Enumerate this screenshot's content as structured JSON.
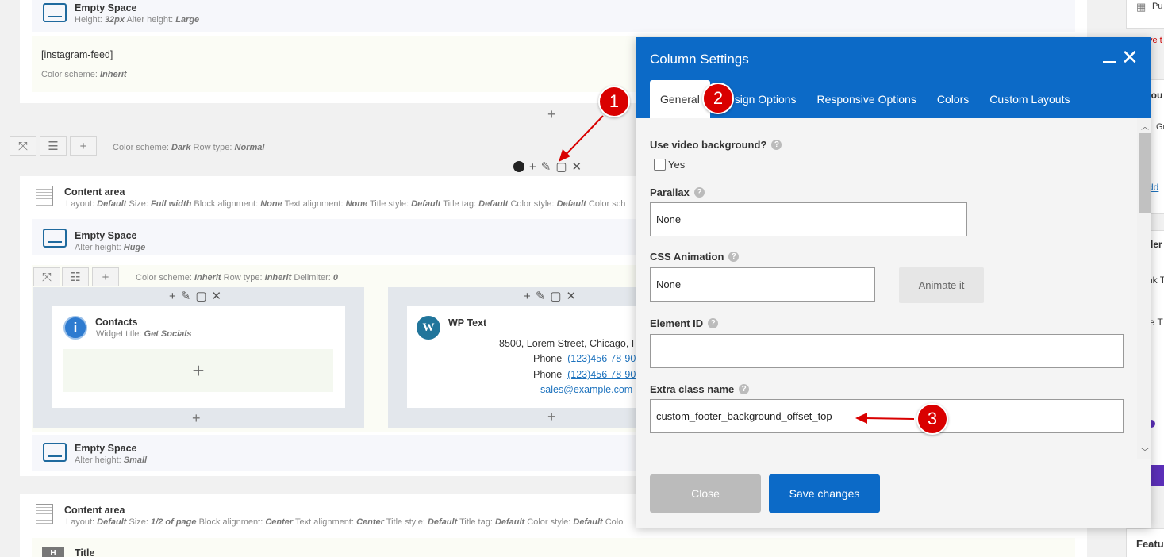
{
  "builder": {
    "empty_space_1": {
      "title": "Empty Space",
      "meta_a_label": "Height:",
      "meta_a_value": "32px",
      "meta_b_label": "Alter height:",
      "meta_b_value": "Large"
    },
    "instagram": {
      "shortcode": "[instagram-feed]",
      "meta_label": "Color scheme:",
      "meta_value": "Inherit"
    },
    "row1": {
      "cs_label": "Color scheme:",
      "cs_value": "Dark",
      "rt_label": "Row type:",
      "rt_value": "Normal"
    },
    "content_area_1": {
      "title": "Content area",
      "meta": [
        [
          "Layout:",
          "Default"
        ],
        [
          "Size:",
          "Full width"
        ],
        [
          "Block alignment:",
          "None"
        ],
        [
          "Text alignment:",
          "None"
        ],
        [
          "Title style:",
          "Default"
        ],
        [
          "Title tag:",
          "Default"
        ],
        [
          "Color style:",
          "Default"
        ],
        [
          "Color sch",
          ""
        ]
      ]
    },
    "empty_space_2": {
      "title": "Empty Space",
      "meta_label": "Alter height:",
      "meta_value": "Huge"
    },
    "inner_row": {
      "cs_label": "Color scheme:",
      "cs_value": "Inherit",
      "rt_label": "Row type:",
      "rt_value": "Inherit",
      "dl_label": "Delimiter:",
      "dl_value": "0"
    },
    "contacts": {
      "title": "Contacts",
      "meta_label": "Widget title:",
      "meta_value": "Get Socials"
    },
    "wp_text": {
      "title": "WP Text",
      "address": "8500, Lorem Street, Chicago, I",
      "phone1_label": "Phone",
      "phone1": "(123)456-78-90",
      "phone2_label": "Phone",
      "phone2": "(123)456-78-90",
      "email": "sales@example.com"
    },
    "empty_space_3": {
      "title": "Empty Space",
      "meta_label": "Alter height:",
      "meta_value": "Small"
    },
    "content_area_2": {
      "title": "Content area",
      "meta": [
        [
          "Layout:",
          "Default"
        ],
        [
          "Size:",
          "1/2 of page"
        ],
        [
          "Block alignment:",
          "Center"
        ],
        [
          "Text alignment:",
          "Center"
        ],
        [
          "Title style:",
          "Default"
        ],
        [
          "Title tag:",
          "Default"
        ],
        [
          "Color style:",
          "Default"
        ],
        [
          "Colo",
          ""
        ]
      ]
    },
    "title_el": {
      "title": "Title"
    }
  },
  "sidebar": {
    "t1": "Pu",
    "t2": "ve t",
    "t3": "rou",
    "t4": "Gr",
    "t5": "dd",
    "t6": "der",
    "t7": "nk T",
    "t8": "le T",
    "t9": "Featu"
  },
  "modal": {
    "title": "Column Settings",
    "tabs": [
      "General",
      "Design Options",
      "Responsive Options",
      "Colors",
      "Custom Layouts"
    ],
    "video_bg": {
      "label": "Use video background?",
      "option": "Yes"
    },
    "parallax": {
      "label": "Parallax",
      "value": "None"
    },
    "css_anim": {
      "label": "CSS Animation",
      "value": "None",
      "button": "Animate it"
    },
    "element_id": {
      "label": "Element ID",
      "value": ""
    },
    "extra_class": {
      "label": "Extra class name",
      "value": "custom_footer_background_offset_top"
    },
    "close_label": "Close",
    "save_label": "Save changes"
  },
  "annotations": [
    "1",
    "2",
    "3"
  ],
  "colors": {
    "accent": "#0c6ac7",
    "annotation": "#d90000",
    "link": "#1e73be"
  }
}
